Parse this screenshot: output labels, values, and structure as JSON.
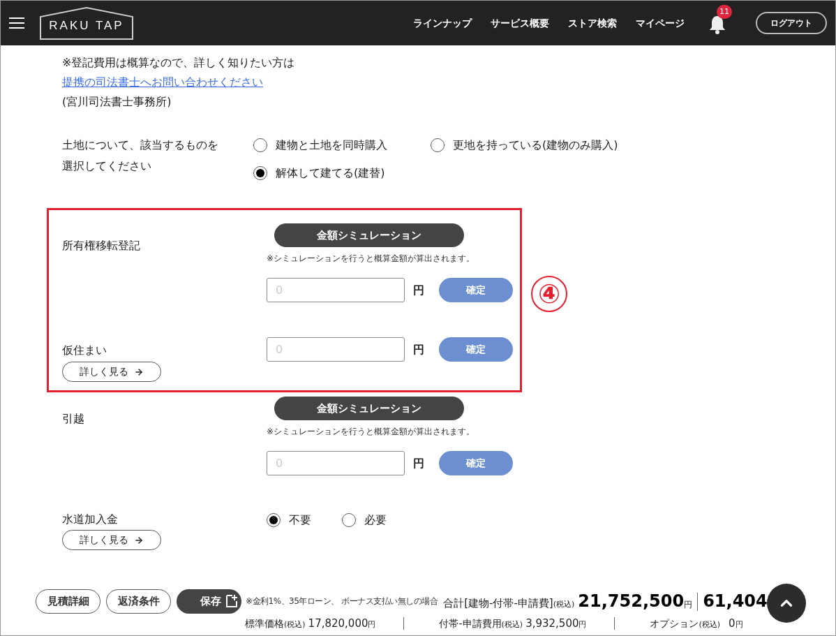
{
  "header": {
    "logo": "RAKU TAP",
    "nav": [
      "ラインナップ",
      "サービス概要",
      "ストア検索",
      "マイページ"
    ],
    "notifications": "11",
    "logout": "ログアウト"
  },
  "notice": {
    "line1": "※登記費用は概算なので、詳しく知りたい方は",
    "link": "提携の司法書士へお問い合わせください",
    "office": "(宮川司法書士事務所)"
  },
  "land": {
    "label": "土地について、該当するものを選択してください",
    "options": [
      {
        "label": "建物と土地を同時購入",
        "selected": false
      },
      {
        "label": "更地を持っている(建物のみ購入)",
        "selected": false
      },
      {
        "label": "解体して建てる(建替)",
        "selected": true
      }
    ]
  },
  "sections": [
    {
      "highlighted": true,
      "badge": "④",
      "items": [
        {
          "kind": "simulation",
          "label": "所有権移転登記",
          "simulate_button": "金額シミュレーション",
          "note": "※シミュレーションを行うと概算金額が算出されます。",
          "placeholder": "0",
          "unit": "円",
          "confirm": "確定"
        },
        {
          "kind": "amount",
          "label": "仮住まい",
          "details": "詳しく見る",
          "placeholder": "0",
          "unit": "円",
          "confirm": "確定"
        }
      ]
    },
    {
      "highlighted": false,
      "items": [
        {
          "kind": "simulation",
          "label": "引越",
          "simulate_button": "金額シミュレーション",
          "note": "※シミュレーションを行うと概算金額が算出されます。",
          "placeholder": "0",
          "unit": "円",
          "confirm": "確定"
        },
        {
          "kind": "choice",
          "label": "水道加入金",
          "details": "詳しく見る",
          "options": [
            {
              "label": "不要",
              "selected": true
            },
            {
              "label": "必要",
              "selected": false
            }
          ]
        }
      ]
    }
  ],
  "footer": {
    "buttons": [
      {
        "label": "見積詳細",
        "kind": "outline"
      },
      {
        "label": "返済条件",
        "kind": "outline"
      },
      {
        "label": "保存",
        "kind": "save"
      }
    ],
    "loan_note": "※金利1%、35年ローン、 ボーナス支払い無しの場合",
    "total": {
      "label": "合計[建物-付帯-申請費]",
      "tax": "(税込)",
      "value": "21,752,500",
      "unit": "円",
      "monthly": "61,404"
    },
    "breakdown": [
      {
        "label": "標準価格",
        "tax": "(税込)",
        "value": "17,820,000",
        "unit": "円"
      },
      {
        "label": "付帯-申請費用",
        "tax": "(税込)",
        "value": "3,932,500",
        "unit": "円"
      },
      {
        "label": "オプション",
        "tax": "(税込)",
        "value": "0",
        "unit": "円"
      }
    ]
  }
}
